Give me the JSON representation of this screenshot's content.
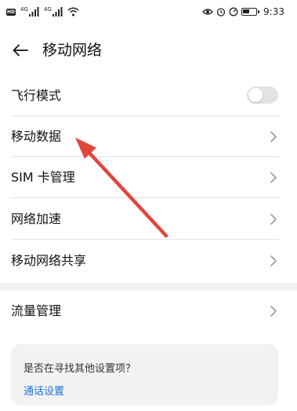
{
  "status_bar": {
    "hd_label": "HD",
    "signal_1": "4G",
    "signal_2": "4G",
    "time": "9:33",
    "battery_level": 0.55
  },
  "header": {
    "title": "移动网络"
  },
  "settings": {
    "items": [
      {
        "label": "飞行模式",
        "control": "toggle",
        "toggle_on": false
      },
      {
        "label": "移动数据",
        "control": "chevron"
      },
      {
        "label": "SIM 卡管理",
        "control": "chevron"
      },
      {
        "label": "网络加速",
        "control": "chevron"
      },
      {
        "label": "移动网络共享",
        "control": "chevron"
      }
    ],
    "traffic_item": {
      "label": "流量管理",
      "control": "chevron"
    }
  },
  "suggestion": {
    "question": "是否在寻找其他设置项？",
    "link": "通话设置"
  },
  "colors": {
    "link": "#1a73d9",
    "annotation_arrow": "#e2453c",
    "toggle_off": "#e3e3e3"
  }
}
